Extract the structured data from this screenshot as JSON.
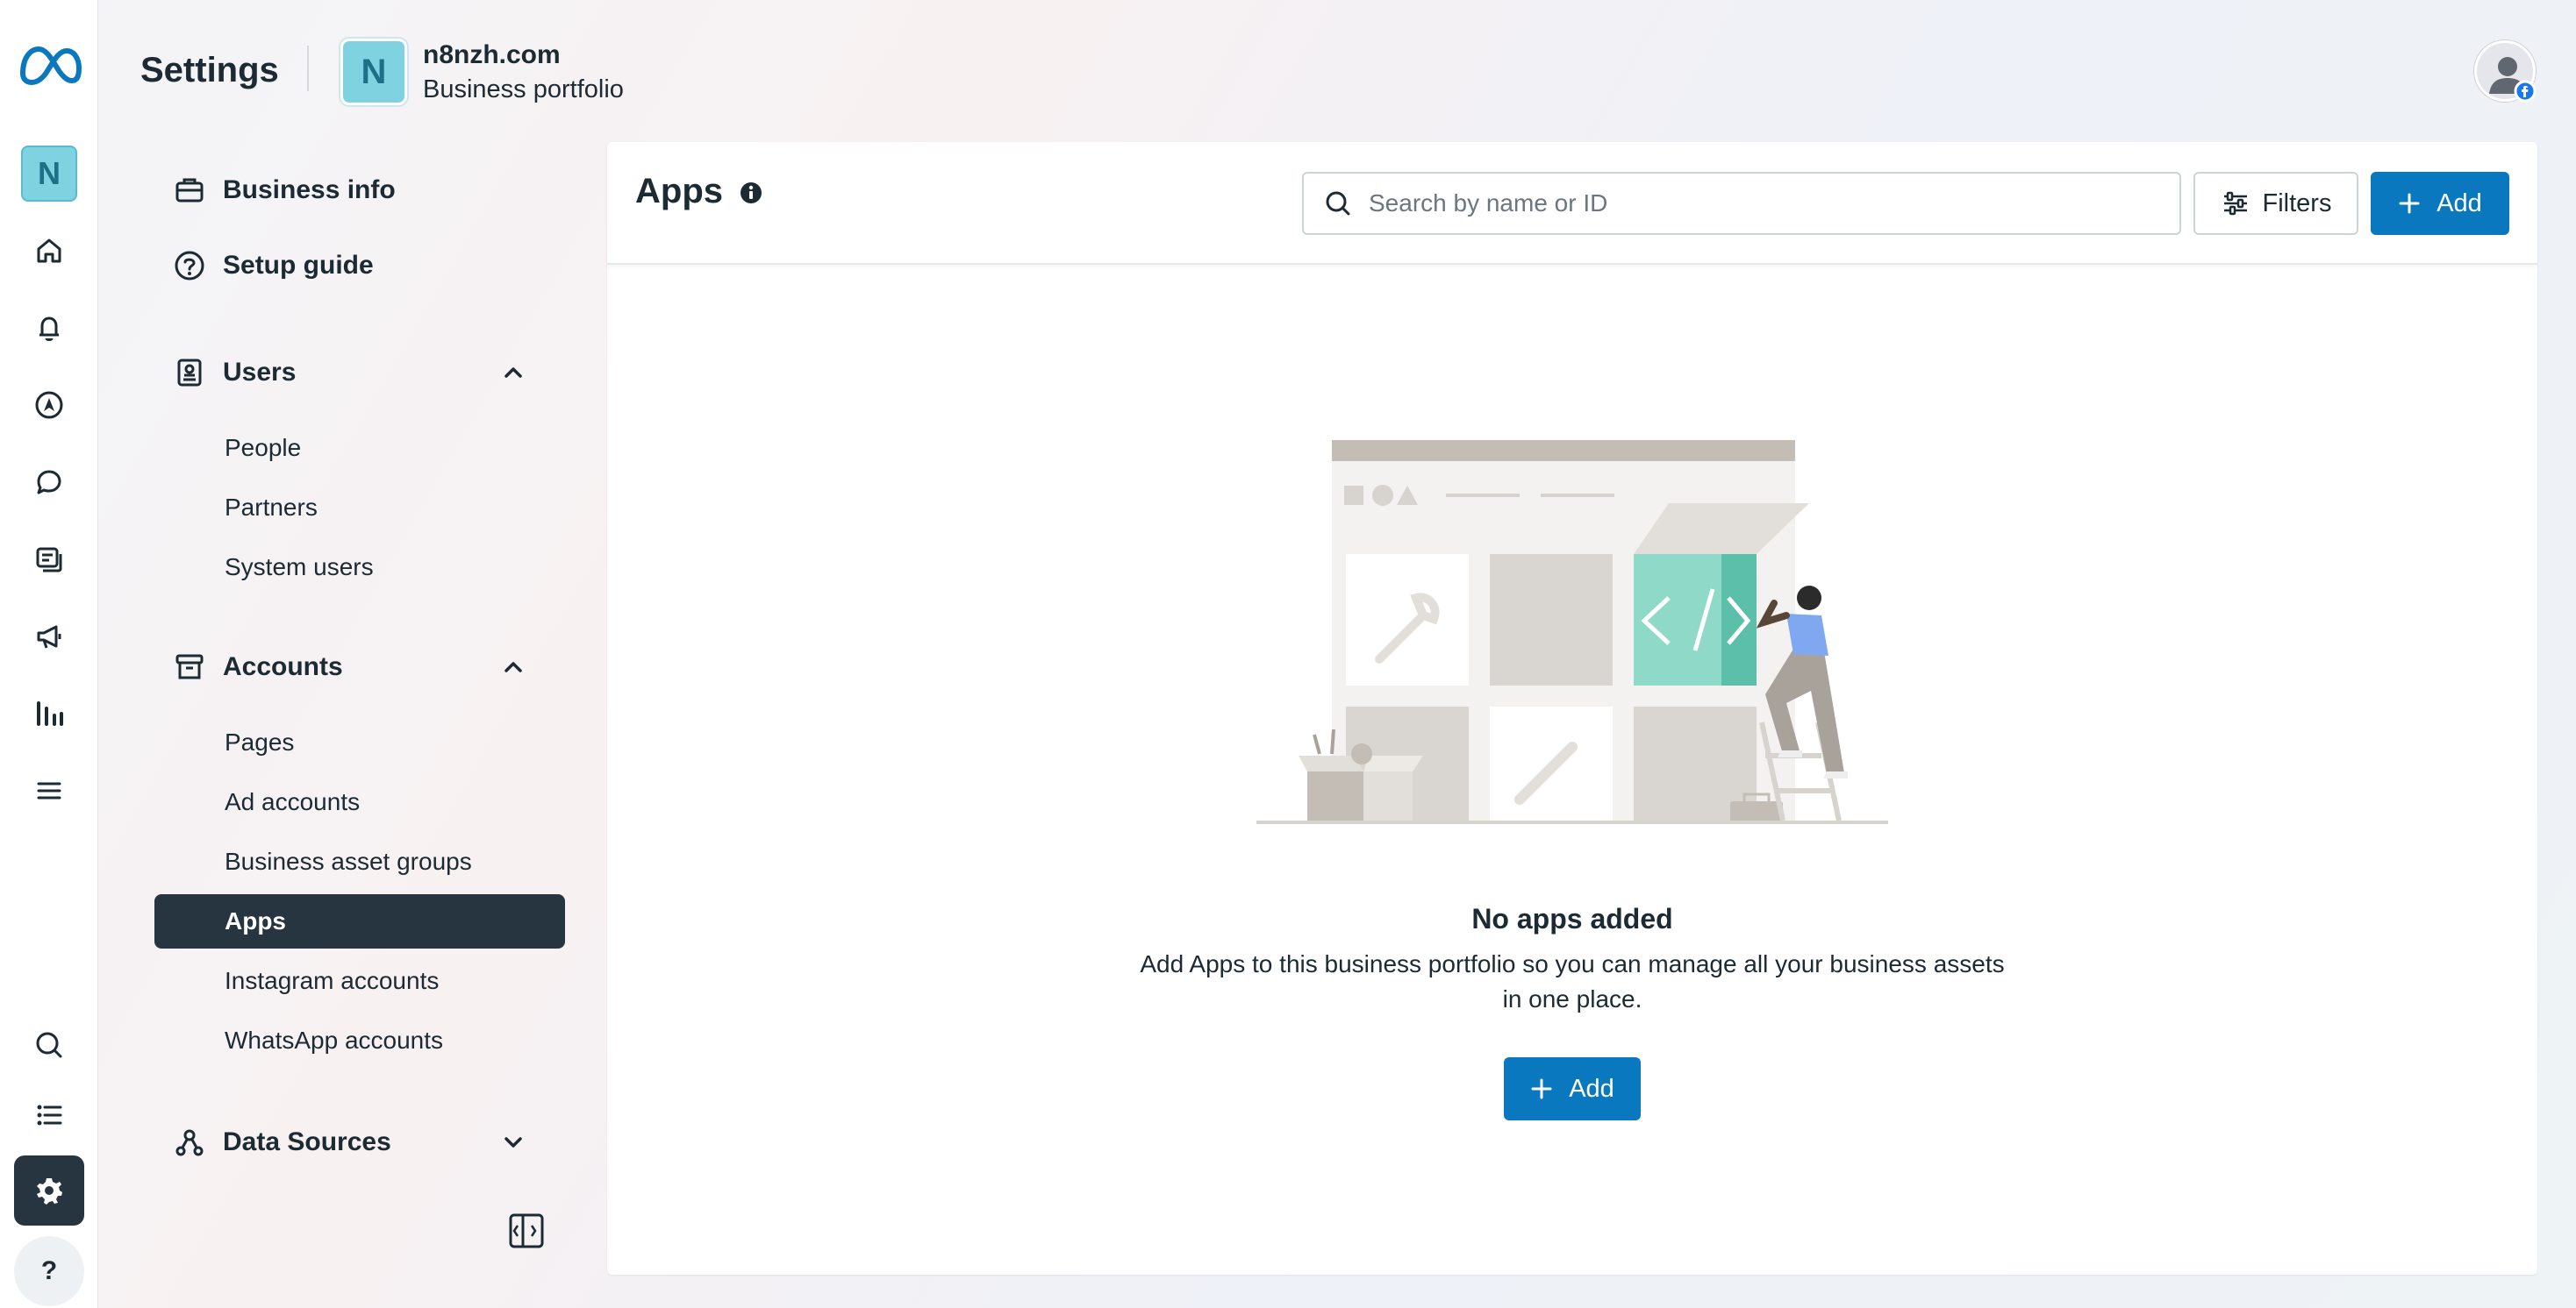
{
  "header": {
    "title": "Settings",
    "portfolio_initial": "N",
    "portfolio_name": "n8nzh.com",
    "portfolio_type": "Business portfolio"
  },
  "rail": {
    "business_initial": "N",
    "help_label": "?"
  },
  "sidebar": {
    "business_info": "Business info",
    "setup_guide": "Setup guide",
    "users": {
      "label": "Users",
      "items": [
        "People",
        "Partners",
        "System users"
      ]
    },
    "accounts": {
      "label": "Accounts",
      "items": [
        "Pages",
        "Ad accounts",
        "Business asset groups",
        "Apps",
        "Instagram accounts",
        "WhatsApp accounts"
      ],
      "active": "Apps"
    },
    "data_sources": "Data Sources"
  },
  "main": {
    "title": "Apps",
    "search_placeholder": "Search by name or ID",
    "filters_label": "Filters",
    "add_label": "Add",
    "empty_title": "No apps added",
    "empty_description": "Add Apps to this business portfolio so you can manage all your business assets in one place.",
    "empty_add_label": "Add"
  },
  "colors": {
    "accent": "#0a78be",
    "active_nav": "#263540",
    "badge": "#7fd3e1"
  }
}
